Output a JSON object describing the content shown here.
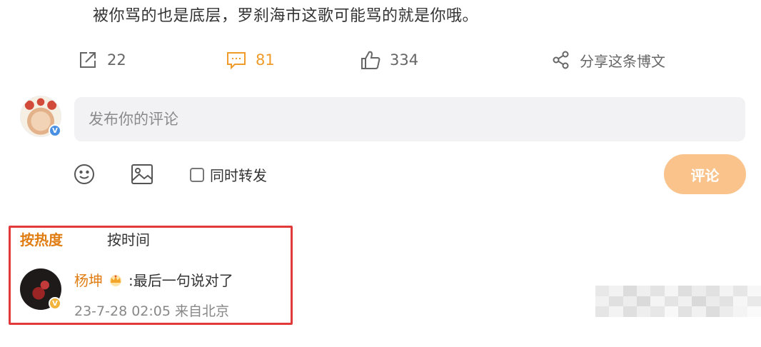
{
  "post": {
    "text": "被你骂的也是底层，罗刹海市这歌可能骂的就是你哦。"
  },
  "actions": {
    "forward_count": "22",
    "comment_count": "81",
    "like_count": "334",
    "share_label": "分享这条博文",
    "accent_color": "#f09b2a"
  },
  "composer": {
    "placeholder": "发布你的评论",
    "repost_label": "同时转发",
    "submit_label": "评论",
    "submit_color": "#f9c38b"
  },
  "sort": {
    "hot_label": "按热度",
    "time_label": "按时间",
    "active_color": "#e07d12"
  },
  "comments": [
    {
      "author": "杨坤",
      "text": ":最后一句说对了",
      "meta": "23-7-28 02:05 来自北京"
    }
  ],
  "highlight_color": "#e13a3a"
}
